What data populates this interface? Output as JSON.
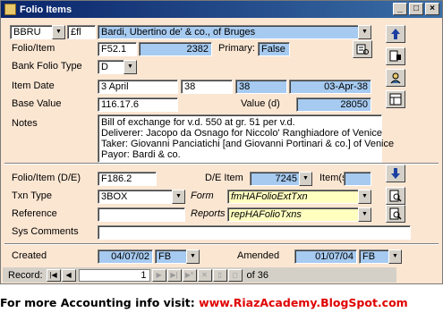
{
  "window": {
    "title": "Folio Items"
  },
  "header": {
    "code": "BBRU",
    "currency": "£fl",
    "name": "Bardi, Ubertino de' & co., of Bruges"
  },
  "folio_item": {
    "label": "Folio/Item",
    "value": "F52.1",
    "number": "2382",
    "primary_label": "Primary:",
    "primary_value": "False"
  },
  "bank_folio_type": {
    "label": "Bank Folio Type",
    "value": "D"
  },
  "item_date": {
    "label": "Item Date",
    "text": "3 April",
    "year": "38",
    "year2": "38",
    "date": "03-Apr-38"
  },
  "base_value": {
    "label": "Base Value",
    "value": "116.17.6",
    "value_d_label": "Value (d)",
    "value_d": "28050"
  },
  "notes": {
    "label": "Notes",
    "lines": [
      "Bill of exchange for v.d. 550 at gr. 51 per v.d.",
      "Deliverer: Jacopo da Osnago for Niccolo' Ranghiadore of Venice",
      "Taker: Giovanni Panciatichi [and Giovanni Portinari & co.] of Venice",
      "Payor: Bardi & co."
    ]
  },
  "folio_item_de": {
    "label": "Folio/Item (D/E)",
    "value": "F186.2",
    "de_item_label": "D/E Item",
    "de_item": "7245",
    "items_label": "Item(s)",
    "items": ""
  },
  "txn_type": {
    "label": "Txn Type",
    "value": "3BOX",
    "form_label": "Form",
    "form_value": "fmHAFolioExtTxn"
  },
  "reference": {
    "label": "Reference",
    "value": "",
    "reports_label": "Reports",
    "reports_value": "repHAFolioTxns"
  },
  "sys_comments": {
    "label": "Sys Comments",
    "value": ""
  },
  "created": {
    "label": "Created",
    "date": "04/07/02",
    "user": "FB"
  },
  "amended": {
    "label": "Amended",
    "date": "01/07/04",
    "user": "FB"
  },
  "nav": {
    "record_label": "Record:",
    "current": "1",
    "of_label": "of",
    "total": "36"
  },
  "footer": {
    "text": "For more Accounting info visit: ",
    "link": "www.RiazAcademy.BlogSpot.com"
  },
  "colors": {
    "form_bg": "#fbe6d2",
    "blue_field": "#a6caf0",
    "yellow_field": "#ffffc0",
    "footer_link": "#e00000"
  }
}
